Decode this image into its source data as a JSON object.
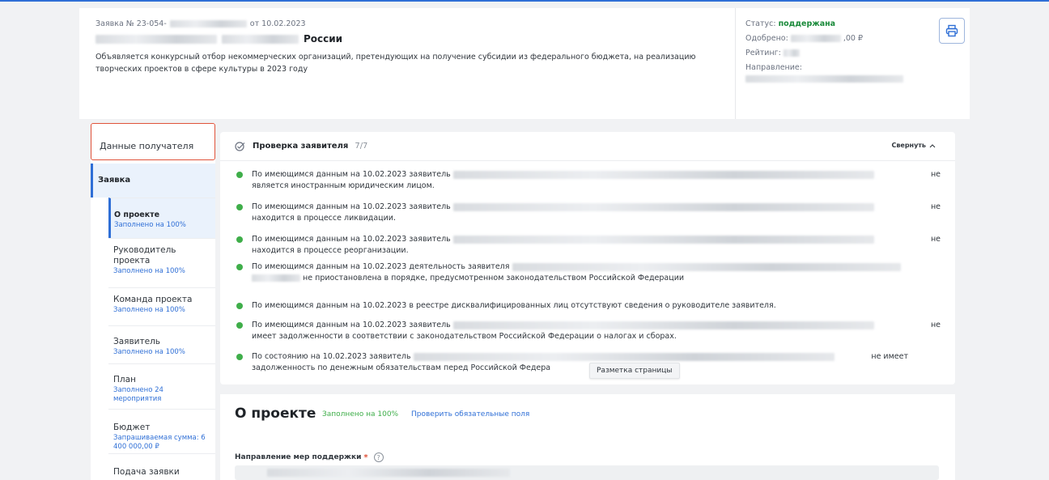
{
  "header": {
    "app_number_prefix": "Заявка № 23-054-",
    "date_text": "от 10.02.2023",
    "title_suffix": "России",
    "description": "Объявляется конкурсный отбор некоммерческих организаций, претендующих на получение субсидии из федерального бюджета, на реализацию творческих проектов в сфере культуры в 2023 году"
  },
  "summary": {
    "status_label": "Статус:",
    "status_value": "поддержана",
    "approved_label": "Одобрено:",
    "approved_value_suffix": ",00 ₽",
    "rating_label": "Рейтинг:",
    "direction_label": "Направление:",
    "print_icon": "printer-icon"
  },
  "sidebar": {
    "recipient": "Данные получателя",
    "application": "Заявка",
    "items": [
      {
        "label": "О проекте",
        "sub": "Заполнено на 100%"
      },
      {
        "label": "Руководитель проекта",
        "sub": "Заполнено на 100%"
      },
      {
        "label": "Команда проекта",
        "sub": "Заполнено на 100%"
      },
      {
        "label": "Заявитель",
        "sub": "Заполнено на 100%"
      },
      {
        "label": "План",
        "sub": "Заполнено 24 мероприятия"
      },
      {
        "label": "Бюджет",
        "sub": "Запрашиваемая сумма: 6 400 000,00 ₽"
      },
      {
        "label": "Подача заявки",
        "sub": ""
      }
    ]
  },
  "check": {
    "title": "Проверка заявителя",
    "count": "7/7",
    "collapse": "Свернуть",
    "items": [
      {
        "line1": "По имеющимся данным на 10.02.2023 заявитель",
        "end": "не",
        "line2": "является иностранным юридическим лицом."
      },
      {
        "line1": "По имеющимся данным на 10.02.2023 заявитель",
        "end": "не",
        "line2": "находится в процессе ликвидации."
      },
      {
        "line1": "По имеющимся данным на 10.02.2023 заявитель",
        "end": "не",
        "line2": "находится в процессе реорганизации."
      },
      {
        "line1": "По имеющимся данным на 10.02.2023 деятельность заявителя",
        "end": "",
        "line2": "не приостановлена в порядке, предусмотренном законодательством Российской Федерации"
      },
      {
        "line1": "По имеющимся данным на 10.02.2023 в реестре дисквалифицированных лиц отсутствуют сведения о руководителе заявителя.",
        "end": "",
        "line2": ""
      },
      {
        "line1": "По имеющимся данным на 10.02.2023 заявитель",
        "end": "не",
        "line2": "имеет задолженности в соответствии с законодательством Российской Федерации о налогах и сборах."
      },
      {
        "line1": "По состоянию на 10.02.2023 заявитель",
        "end": "не имеет",
        "line2": "задолженность по денежным обязательствам перед Российской Федера"
      }
    ]
  },
  "tooltip": "Разметка страницы",
  "about": {
    "title": "О проекте",
    "filled": "Заполнено на 100%",
    "check_fields": "Проверить обязательные поля",
    "support_label": "Направление мер поддержки",
    "required_mark": "*",
    "help": "?"
  },
  "colors": {
    "accent": "#2f6fd6",
    "success": "#3fae4a",
    "highlight": "#e0533a"
  }
}
